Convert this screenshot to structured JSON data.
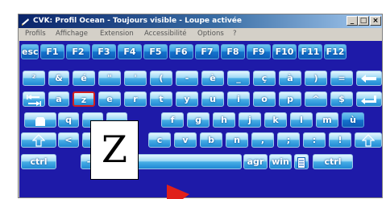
{
  "window": {
    "title": "CVK: Profil Ocean - Toujours visible - Loupe activée",
    "buttons": {
      "minimize": "_",
      "maximize": "□",
      "close": "×"
    }
  },
  "menu": [
    "Profils",
    "Affichage",
    "Extension",
    "Accessibilité",
    "Options",
    "?"
  ],
  "rows": [
    [
      {
        "label": "esc"
      },
      {
        "label": "F1"
      },
      {
        "label": "F2"
      },
      {
        "label": "F3"
      },
      {
        "label": "F4"
      },
      {
        "label": "F5"
      },
      {
        "label": "F6"
      },
      {
        "label": "F7"
      },
      {
        "label": "F8"
      },
      {
        "label": "F9"
      },
      {
        "label": "F10"
      },
      {
        "label": "F11"
      },
      {
        "label": "F12"
      }
    ],
    [
      {
        "label": "²"
      },
      {
        "label": "&"
      },
      {
        "label": "é"
      },
      {
        "label": "\""
      },
      {
        "label": "'"
      },
      {
        "label": "("
      },
      {
        "label": "-"
      },
      {
        "label": "è"
      },
      {
        "label": "_"
      },
      {
        "label": "ç"
      },
      {
        "label": "à"
      },
      {
        "label": ")"
      },
      {
        "label": "="
      },
      {
        "icon": "backspace-icon"
      }
    ],
    [
      {
        "icon": "tab-icon"
      },
      {
        "label": "a"
      },
      {
        "label": "z",
        "highlight": true
      },
      {
        "label": "e"
      },
      {
        "label": "r"
      },
      {
        "label": "t"
      },
      {
        "label": "y"
      },
      {
        "label": "u"
      },
      {
        "label": "i"
      },
      {
        "label": "o"
      },
      {
        "label": "p"
      },
      {
        "label": "^"
      },
      {
        "label": "$"
      },
      {
        "icon": "enter-icon"
      }
    ],
    [
      {
        "icon": "caps-lock-icon"
      },
      {
        "label": "q"
      },
      {
        "label": ""
      },
      {
        "label": ""
      },
      {
        "label": "f"
      },
      {
        "label": "g"
      },
      {
        "label": "h"
      },
      {
        "label": "j"
      },
      {
        "label": "k"
      },
      {
        "label": "l"
      },
      {
        "label": "m"
      },
      {
        "label": "ù"
      },
      {
        "label": "*"
      }
    ],
    [
      {
        "icon": "shift-left-icon"
      },
      {
        "label": "<"
      },
      {
        "label": ""
      },
      {
        "label": ""
      },
      {
        "label": "c"
      },
      {
        "label": "v"
      },
      {
        "label": "b"
      },
      {
        "label": "n"
      },
      {
        "label": ","
      },
      {
        "label": ";"
      },
      {
        "label": ":"
      },
      {
        "label": "!"
      },
      {
        "icon": "shift-right-icon"
      }
    ],
    [
      {
        "label": "ctrl"
      },
      {
        "label": "-"
      },
      {
        "label": "+"
      },
      {
        "label": ""
      },
      {
        "label": "agr"
      },
      {
        "label": "win"
      },
      {
        "icon": "menu-key-icon"
      },
      {
        "label": "ctrl"
      }
    ]
  ],
  "magnifier": {
    "letter": "Z"
  },
  "colors": {
    "keyboard_bg": "#1e1aa8",
    "key_highlight": "#d02020",
    "titlebar": "#0a246a",
    "pointer": "#e0201a"
  }
}
